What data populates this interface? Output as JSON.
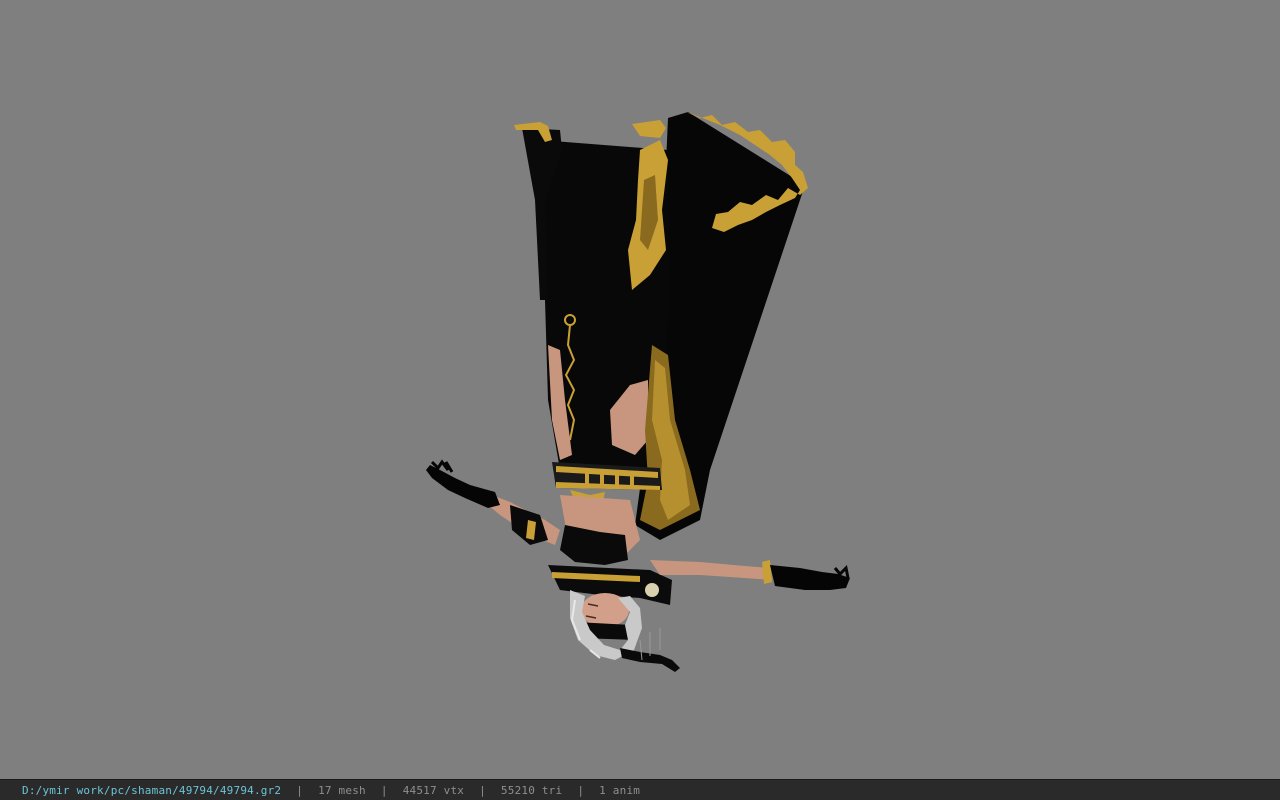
{
  "statusbar": {
    "file_path": "D:/ymir work/pc/shaman/49794/49794.gr2",
    "separator": "|",
    "mesh_count": "17 mesh",
    "vertex_count": "44517 vtx",
    "triangle_count": "55210 tri",
    "anim_count": "1 anim"
  },
  "colors": {
    "viewport_background": "#7f7f7f",
    "statusbar_background": "#2a2a2a",
    "path_text": "#6cc3d6",
    "info_text": "#8f8f8f",
    "robe": "#070707",
    "gold_trim": "#c9a035",
    "skin": "#c8967e",
    "hair": "#c9c9c9"
  }
}
